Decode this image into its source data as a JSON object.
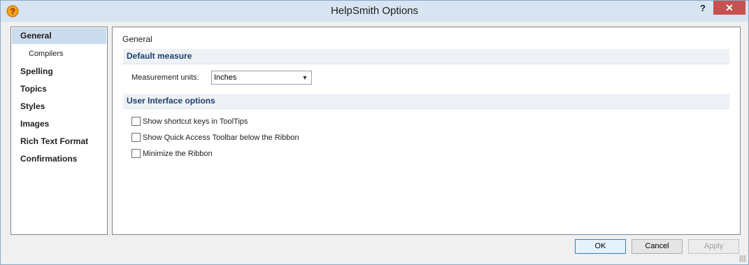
{
  "window": {
    "title": "HelpSmith Options",
    "help_glyph": "?",
    "close_glyph": "✕"
  },
  "nav": {
    "items": [
      {
        "label": "General"
      },
      {
        "label": "Compilers"
      },
      {
        "label": "Spelling"
      },
      {
        "label": "Topics"
      },
      {
        "label": "Styles"
      },
      {
        "label": "Images"
      },
      {
        "label": "Rich Text Format"
      },
      {
        "label": "Confirmations"
      }
    ]
  },
  "panel": {
    "title": "General",
    "default_measure": {
      "header": "Default measure",
      "units_label": "Measurement units:",
      "units_value": "Inches"
    },
    "ui_options": {
      "header": "User Interface options",
      "checkboxes": [
        {
          "label": "Show shortcut keys in ToolTips",
          "checked": false
        },
        {
          "label": "Show Quick Access Toolbar below the Ribbon",
          "checked": false
        },
        {
          "label": "Minimize the Ribbon",
          "checked": false
        }
      ]
    }
  },
  "buttons": {
    "ok": "OK",
    "cancel": "Cancel",
    "apply": "Apply"
  },
  "colors": {
    "selection": "#ccdcef",
    "close": "#c75050",
    "section_header_text": "#1e3f6e"
  }
}
